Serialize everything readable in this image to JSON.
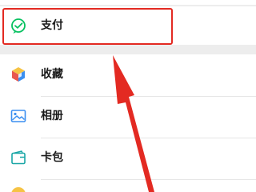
{
  "menu": {
    "pay": {
      "label": "支付",
      "icon": "wechat-pay-icon"
    },
    "items": [
      {
        "label": "收藏",
        "icon": "favorites-cube-icon"
      },
      {
        "label": "相册",
        "icon": "album-icon"
      },
      {
        "label": "卡包",
        "icon": "card-wallet-icon"
      }
    ]
  },
  "annotation": {
    "highlight_color": "#e32a22",
    "arrow_color": "#e32a22"
  },
  "colors": {
    "background": "#ededed",
    "card": "#ffffff",
    "pay_green": "#07c160",
    "text": "#191919"
  }
}
